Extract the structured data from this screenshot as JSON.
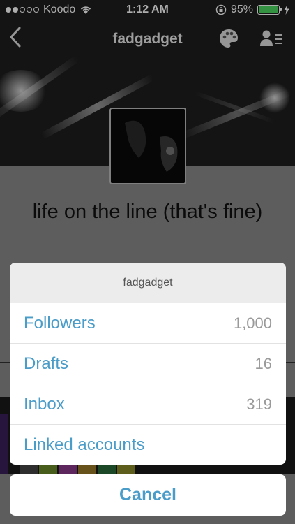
{
  "status": {
    "carrier": "Koodo",
    "time": "1:12 AM",
    "battery": "95%",
    "battery_level": 0.95
  },
  "nav": {
    "title": "fadgadget",
    "back_icon": "chevron-left-icon",
    "theme_icon": "palette-icon",
    "account_icon": "person-list-icon"
  },
  "blog": {
    "title": "life on the line (that's fine)"
  },
  "sheet": {
    "header": "fadgadget",
    "items": [
      {
        "label": "Followers",
        "count": "1,000"
      },
      {
        "label": "Drafts",
        "count": "16"
      },
      {
        "label": "Inbox",
        "count": "319"
      },
      {
        "label": "Linked accounts",
        "count": ""
      }
    ],
    "cancel": "Cancel"
  },
  "colors": {
    "accent": "#4a9cc9",
    "battery": "#4cd964"
  }
}
